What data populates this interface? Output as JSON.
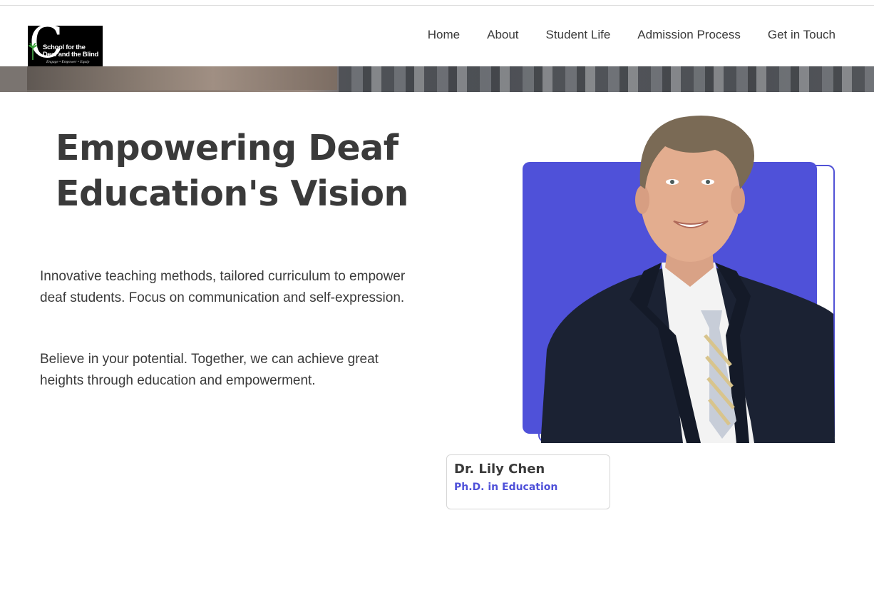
{
  "header": {
    "logo": {
      "line1": "School for the",
      "line2": "Deaf and the Blind",
      "tagline": "Engage • Empower • Equip"
    },
    "nav": [
      "Home",
      "About",
      "Student Life",
      "Admission Process",
      "Get in Touch"
    ]
  },
  "hero": {
    "title_line1": "Empowering Deaf",
    "title_line2": "Education's Vision",
    "paragraph1_line1": "Innovative teaching methods, tailored curriculum to empower",
    "paragraph1_line2": "deaf students. Focus on communication and self-expression.",
    "paragraph2_line1": "Believe in your potential. Together, we can achieve great",
    "paragraph2_line2": "heights through education and empowerment."
  },
  "profile": {
    "name": "Dr. Lily Chen",
    "degree": "Ph.D. in Education",
    "accent_color": "#4f51d9"
  },
  "colors": {
    "text": "#3a3a3a",
    "accent": "#4f51d9",
    "background": "#ffffff"
  }
}
